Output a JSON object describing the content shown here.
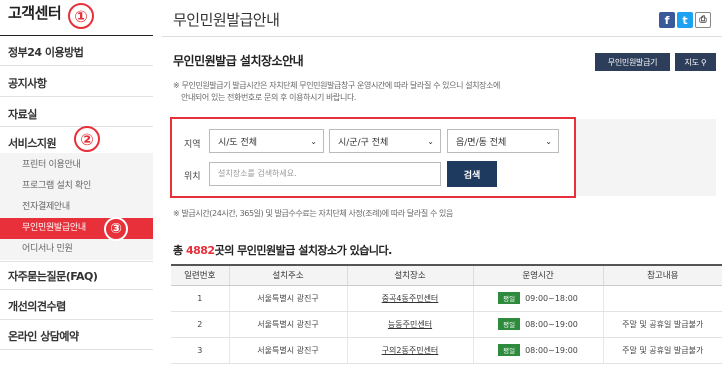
{
  "sidebar": {
    "title": "고객센터",
    "items": [
      {
        "label": "정부24 이용방법"
      },
      {
        "label": "공지사항"
      },
      {
        "label": "자료실"
      },
      {
        "label": "서비스지원"
      },
      {
        "label": "자주묻는질문(FAQ)"
      },
      {
        "label": "개선의견수렴"
      },
      {
        "label": "온라인 상담예약"
      }
    ],
    "sub_items": [
      {
        "label": "프린터 이용안내"
      },
      {
        "label": "프로그램 설치 확인"
      },
      {
        "label": "전자결제안내"
      },
      {
        "label": "무인민원발급안내"
      },
      {
        "label": "어디서나 민원"
      }
    ]
  },
  "badges": [
    "①",
    "②",
    "③"
  ],
  "header": {
    "title": "무인민원발급안내",
    "share_icons": [
      "facebook-icon",
      "twitter-icon",
      "print-icon"
    ],
    "facebook_glyph": "f",
    "twitter_glyph": "t",
    "print_glyph": "⎙"
  },
  "section": {
    "title": "무인민원발급 설치장소안내",
    "btn_kiosk": "무인민원발급기",
    "btn_map": "지도 ⚲",
    "notice1": "※ 무인민원발급기 발급시간은 자치단체 무인민원발급창구 운영시간에 따라 달라질 수 있으니 설치장소에",
    "notice2": "안내되어 있는 전화번호로 문의 후 이용하시기 바랍니다."
  },
  "search": {
    "region_label": "지역",
    "location_label": "위치",
    "sido": "시/도 전체",
    "sigungu": "시/군/구 전체",
    "eupmyeon": "읍/면/동 전체",
    "placeholder": "설치장소를 검색하세요.",
    "button": "검색"
  },
  "footnote": "※ 발급시간(24시간, 365일) 및 발급수수료는 자치단체 사정(조례)에 따라 달라질 수 있음",
  "summary": {
    "prefix": "총 ",
    "count": "4882",
    "suffix": "곳의 무인민원발급 설치장소가 있습니다."
  },
  "table": {
    "headers": [
      "일련번호",
      "설치주소",
      "설치장소",
      "운영시간",
      "참고내용"
    ],
    "rows": [
      {
        "no": "1",
        "addr": "서울특별시 광진구",
        "place": "중곡4동주민센터",
        "tag": "평일",
        "time": "09:00~18:00",
        "note": ""
      },
      {
        "no": "2",
        "addr": "서울특별시 광진구",
        "place": "능동주민센터",
        "tag": "평일",
        "time": "08:00~19:00",
        "note": "주말 및 공휴일 발급불가"
      },
      {
        "no": "3",
        "addr": "서울특별시 광진구",
        "place": "구의2동주민센터",
        "tag": "평일",
        "time": "08:00~19:00",
        "note": "주말 및 공휴일 발급불가"
      }
    ]
  },
  "colors": {
    "accent": "#e8303a",
    "navy": "#2c3e5a",
    "green": "#2e8b3d"
  }
}
